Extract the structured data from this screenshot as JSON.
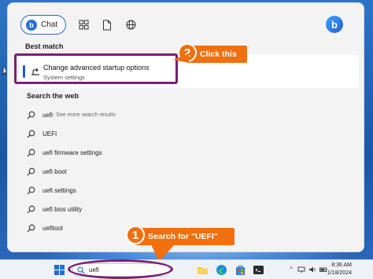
{
  "search_panel": {
    "tabs": {
      "chat_label": "Chat",
      "chat_logo_letter": "b",
      "apps_icon": "apps-grid-icon",
      "documents_icon": "document-icon",
      "web_icon": "globe-icon"
    },
    "bing_button_letter": "b",
    "best_match_heading": "Best match",
    "best_match": {
      "title": "Change advanced startup options",
      "subtitle": "System settings",
      "icon": "settings-startup-icon"
    },
    "web_heading": "Search the web",
    "web_results": [
      {
        "query": "uefi",
        "suffix": " - See more search results"
      },
      {
        "query": "UEFI",
        "suffix": ""
      },
      {
        "query": "uefi firmware settings",
        "suffix": ""
      },
      {
        "query": "uefi boot",
        "suffix": ""
      },
      {
        "query": "uefi settings",
        "suffix": ""
      },
      {
        "query": "uefi bios utility",
        "suffix": ""
      },
      {
        "query": "uefitool",
        "suffix": ""
      }
    ]
  },
  "annotations": {
    "step1": {
      "number": "1",
      "text": "Search for \"UEFI\""
    },
    "step2": {
      "number": "2",
      "text": "Click this"
    },
    "accent_color": "#f06f0f",
    "highlight_color": "#7a1f73"
  },
  "taskbar": {
    "search_value": "uefi",
    "time": "8:36 AM",
    "date": "1/18/2024",
    "tray_chevron": "^",
    "icons": [
      "windows-start-icon",
      "file-explorer-icon",
      "edge-icon",
      "store-icon",
      "terminal-icon",
      "chevron-up-icon",
      "network-icon",
      "volume-icon",
      "battery-icon"
    ]
  }
}
